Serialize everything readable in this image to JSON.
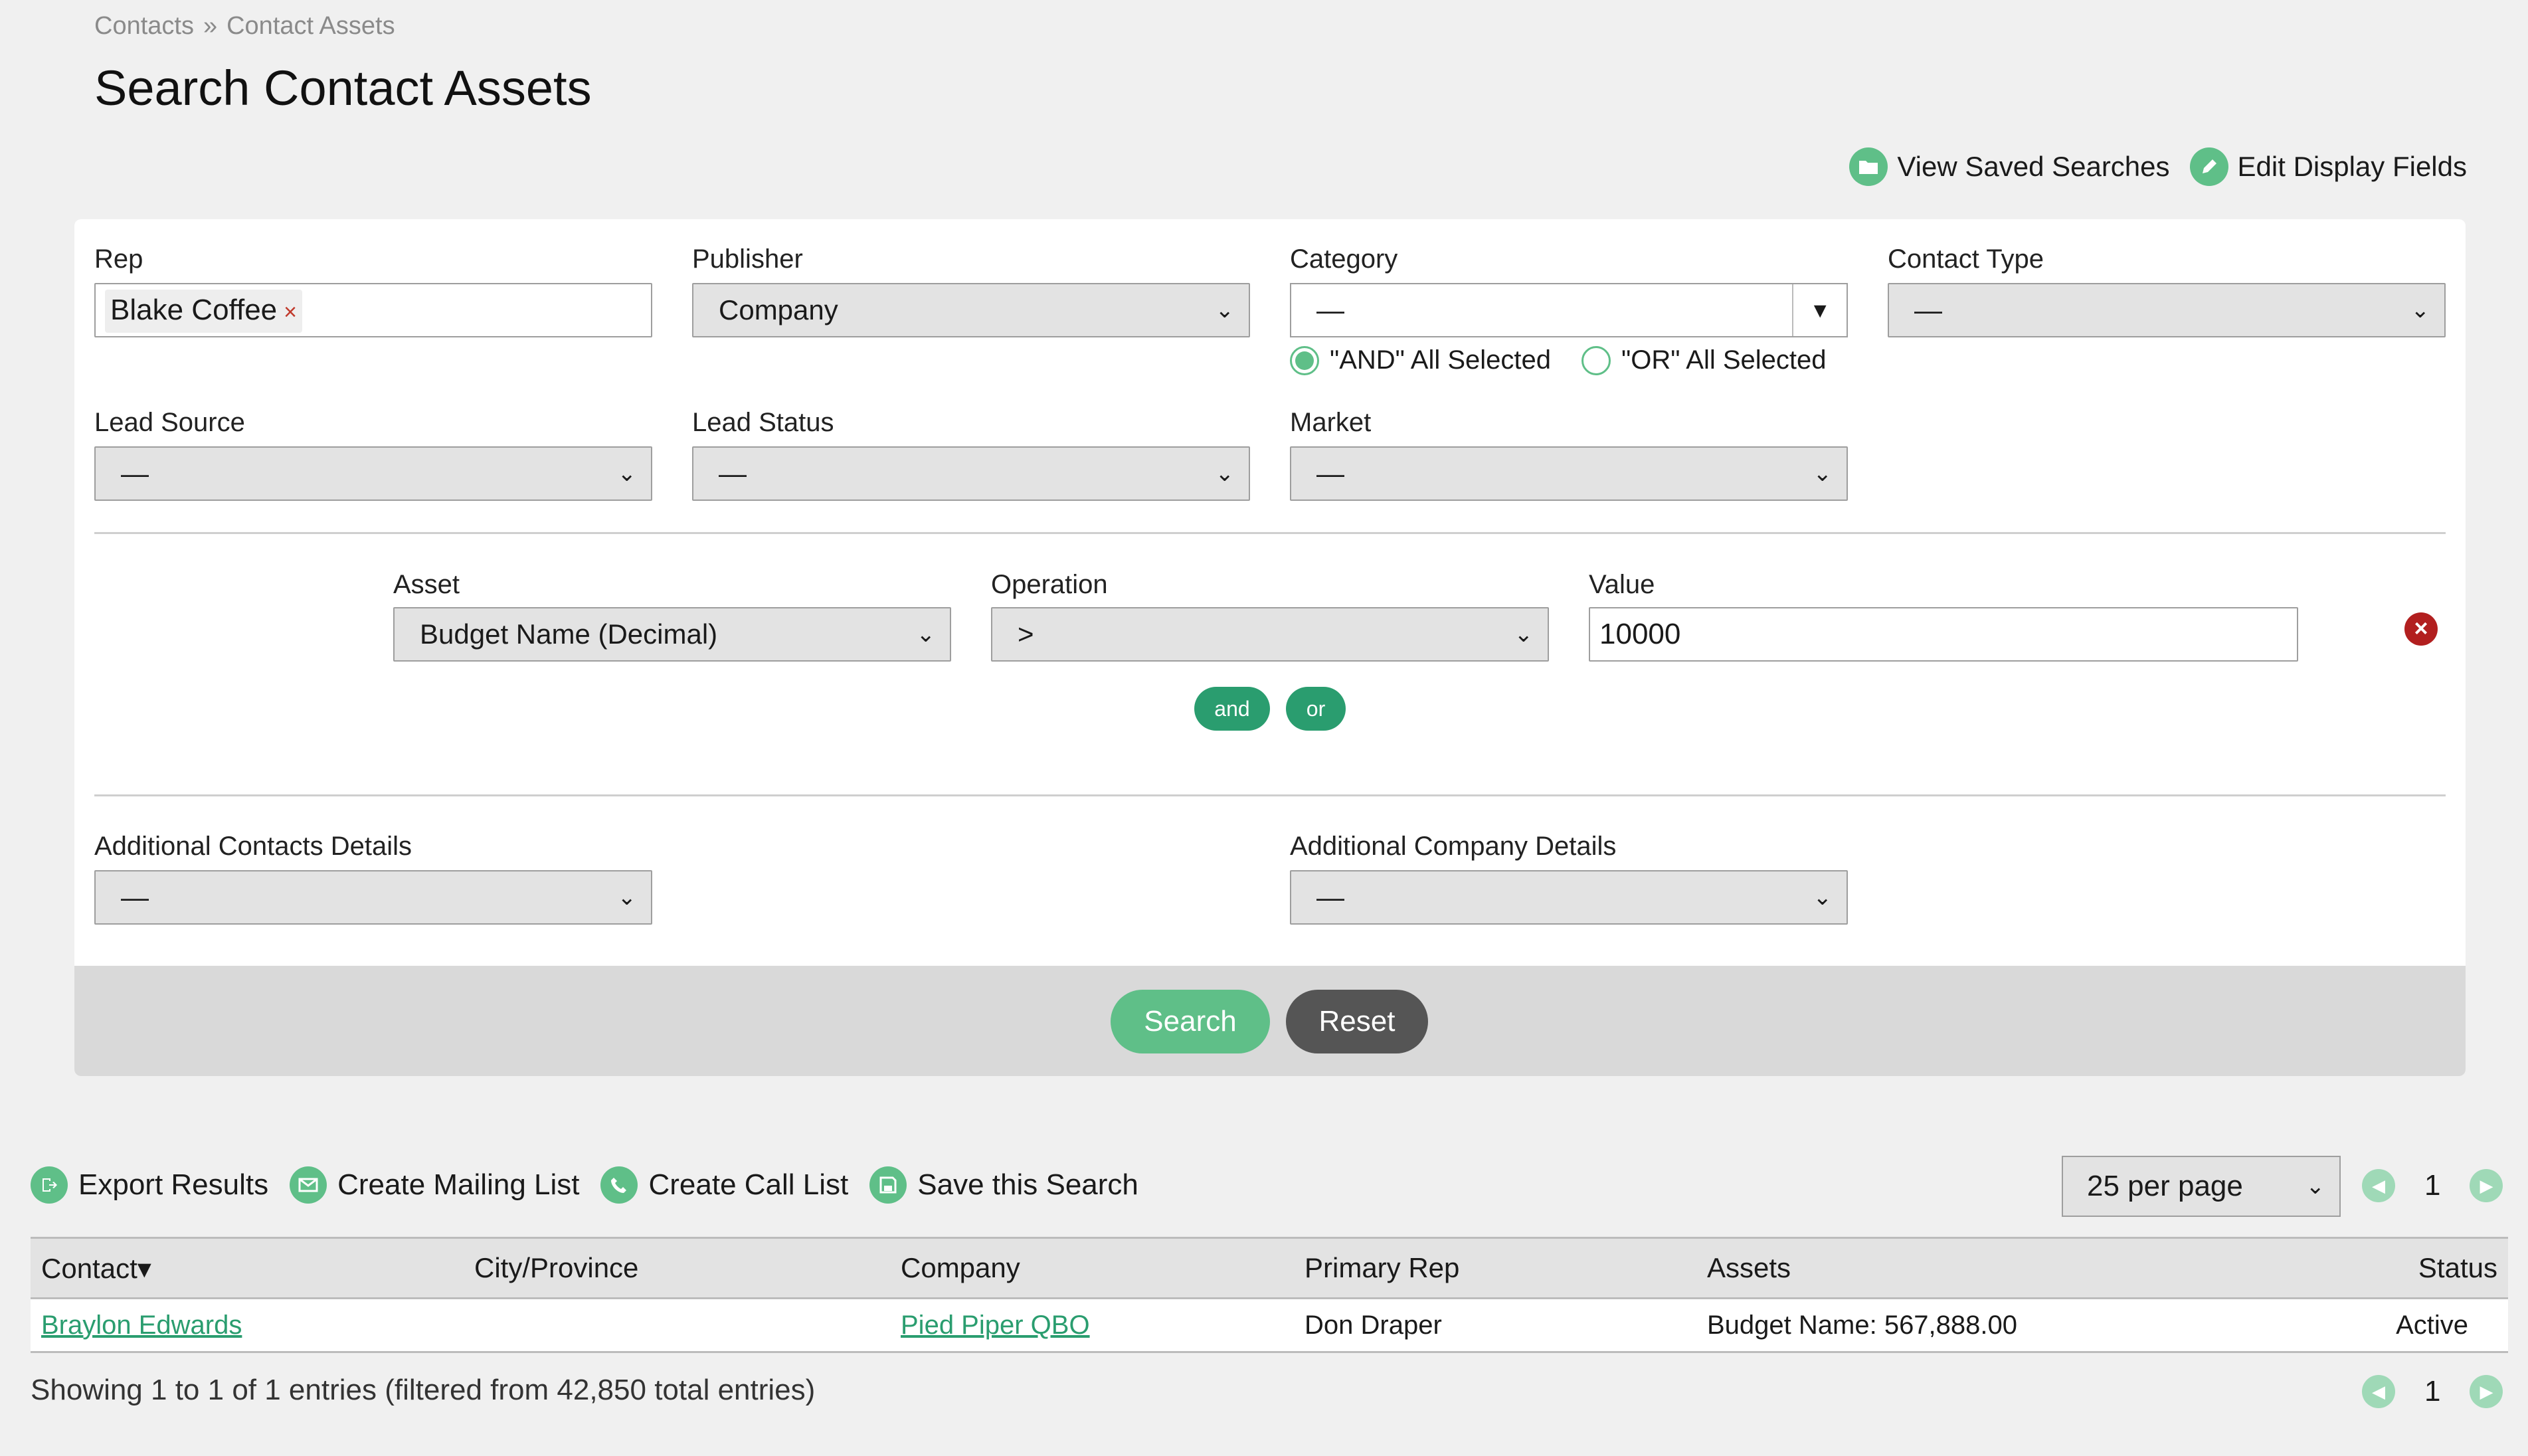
{
  "breadcrumb": {
    "root": "Contacts",
    "sep": "»",
    "current": "Contact Assets"
  },
  "page_title": "Search Contact Assets",
  "top_links": {
    "saved": "View Saved Searches",
    "edit": "Edit Display Fields"
  },
  "filters": {
    "rep": {
      "label": "Rep",
      "tag": "Blake Coffee",
      "tag_remove": "×"
    },
    "publisher": {
      "label": "Publisher",
      "value": "Company"
    },
    "category": {
      "label": "Category",
      "value": "—",
      "radio_and": "\"AND\" All Selected",
      "radio_or": "\"OR\" All Selected",
      "selected": "and"
    },
    "contact_type": {
      "label": "Contact Type",
      "value": "—"
    },
    "lead_source": {
      "label": "Lead Source",
      "value": "—"
    },
    "lead_status": {
      "label": "Lead Status",
      "value": "—"
    },
    "market": {
      "label": "Market",
      "value": "—"
    }
  },
  "asset_rule": {
    "asset_label": "Asset",
    "asset_value": "Budget Name (Decimal)",
    "operation_label": "Operation",
    "operation_value": ">",
    "value_label": "Value",
    "value": "10000",
    "and_label": "and",
    "or_label": "or"
  },
  "additional": {
    "contacts_label": "Additional Contacts Details",
    "contacts_value": "—",
    "company_label": "Additional Company Details",
    "company_value": "—"
  },
  "buttons": {
    "search": "Search",
    "reset": "Reset"
  },
  "actions": {
    "export": "Export Results",
    "mailing": "Create Mailing List",
    "call": "Create Call List",
    "save": "Save this Search"
  },
  "pagination": {
    "per_page": "25 per page",
    "page": "1"
  },
  "table": {
    "columns": [
      "Contact",
      "City/Province",
      "Company",
      "Primary Rep",
      "Assets",
      "Status"
    ],
    "sort_indicator": "▾",
    "rows": [
      {
        "contact": "Braylon Edwards",
        "city": "",
        "company": "Pied Piper QBO",
        "rep": "Don Draper",
        "assets": "Budget Name: 567,888.00",
        "status": "Active"
      }
    ]
  },
  "showing": "Showing 1 to 1 of 1 entries (filtered from 42,850 total entries)",
  "colors": {
    "accent": "#5fbf88",
    "accent_dark": "#2a9d6f",
    "danger": "#b21f1f",
    "reset": "#555555"
  }
}
